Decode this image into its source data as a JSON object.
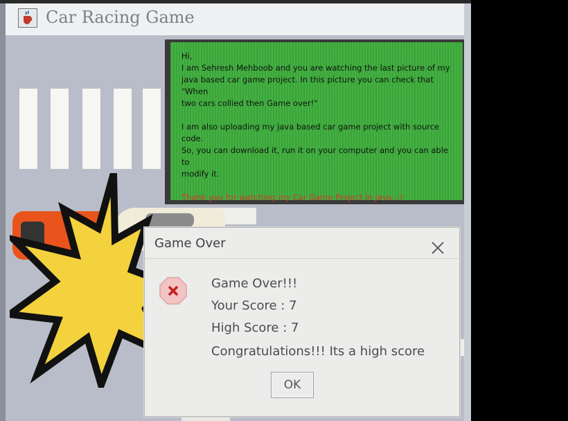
{
  "window": {
    "title": "Car Racing Game",
    "icon": "java-cup-icon"
  },
  "message_panel": {
    "lines_block1": [
      "Hi,",
      "I am Sehresh Mehboob and you are watching the last picture of my",
      "java based car game project. In this picture you can check that \"When",
      "two cars collied then Game  over!\""
    ],
    "lines_block2": [
      "I am also uploading my java based car game project with source code.",
      "So, you can download it, run it on your computer and you can able to",
      "modify it."
    ],
    "thanks": "Thank you for watching my Car Game Project in Java :-)",
    "background_color": "#3fae3d",
    "thanks_color": "#d23a2a"
  },
  "dialog": {
    "title": "Game Over",
    "icon": "error-x-icon",
    "lines": [
      "Game Over!!!",
      "Your Score : 7",
      "High Score : 7",
      "Congratulations!!! Its a high score"
    ],
    "ok_label": "OK"
  }
}
